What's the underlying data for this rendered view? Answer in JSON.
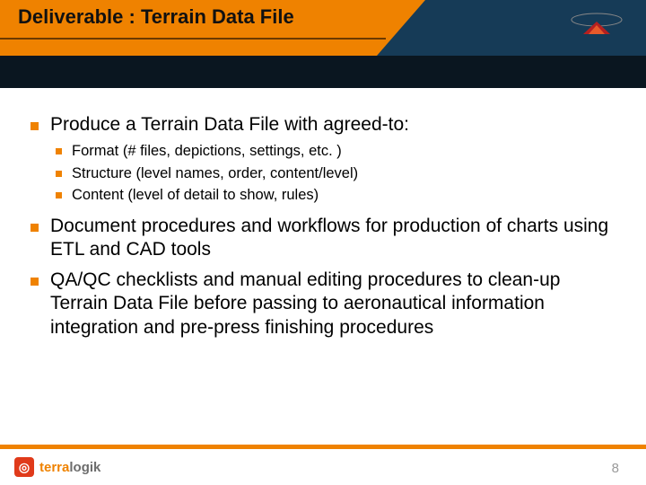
{
  "header": {
    "title": "Deliverable : Terrain Data File"
  },
  "content": {
    "items": [
      {
        "text": "Produce a Terrain Data File with agreed-to:",
        "sub": [
          "Format (# files, depictions, settings, etc. )",
          "Structure (level names, order, content/level)",
          "Content (level of detail to show, rules)"
        ]
      },
      {
        "text": "Document procedures and workflows for production of charts using ETL and CAD tools"
      },
      {
        "text": "QA/QC checklists and manual editing procedures to clean-up Terrain Data File before passing to aeronautical information integration and pre-press finishing procedures"
      }
    ]
  },
  "footer": {
    "page_number": "8",
    "brand_prefix": "terra",
    "brand_suffix": "logik"
  }
}
